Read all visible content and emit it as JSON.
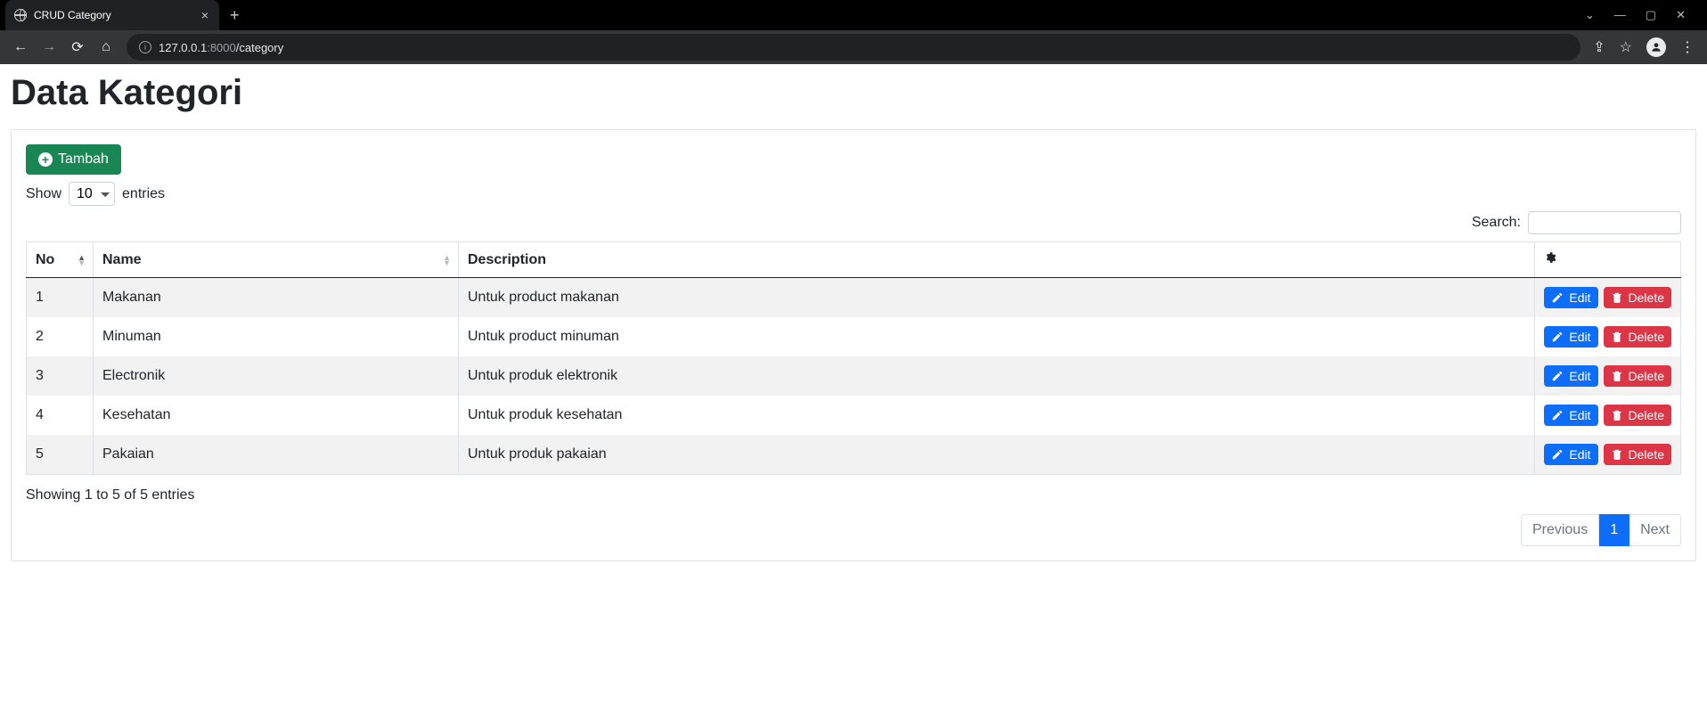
{
  "browser": {
    "tab_title": "CRUD Category",
    "url_host": "127.0.0.1",
    "url_port": ":8000",
    "url_path": "/category"
  },
  "page": {
    "title": "Data Kategori",
    "add_button": "Tambah",
    "length": {
      "show": "Show",
      "value": "10",
      "entries": "entries"
    },
    "search_label": "Search:",
    "columns": {
      "no": "No",
      "name": "Name",
      "description": "Description"
    },
    "rows": [
      {
        "no": "1",
        "name": "Makanan",
        "desc": "Untuk product makanan"
      },
      {
        "no": "2",
        "name": "Minuman",
        "desc": "Untuk product minuman"
      },
      {
        "no": "3",
        "name": "Electronik",
        "desc": "Untuk produk elektronik"
      },
      {
        "no": "4",
        "name": "Kesehatan",
        "desc": "Untuk produk kesehatan"
      },
      {
        "no": "5",
        "name": "Pakaian",
        "desc": "Untuk produk pakaian"
      }
    ],
    "buttons": {
      "edit": "Edit",
      "delete": "Delete"
    },
    "info": "Showing 1 to 5 of 5 entries",
    "pagination": {
      "prev": "Previous",
      "page": "1",
      "next": "Next"
    }
  }
}
